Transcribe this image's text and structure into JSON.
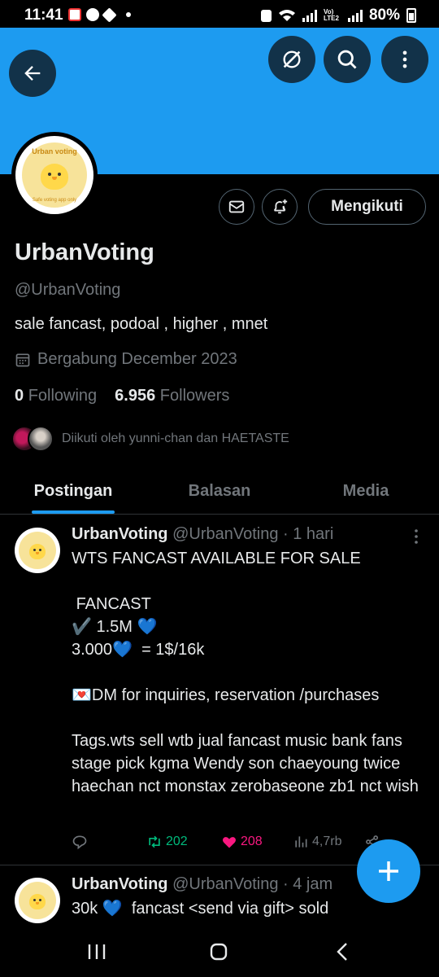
{
  "status_bar": {
    "time": "11:41",
    "battery": "80%",
    "lte_label": "Vo) LTE2"
  },
  "header": {
    "back_icon": "arrow-left-icon",
    "grok_icon": "slash-circle-icon",
    "search_icon": "search-icon",
    "more_icon": "vertical-dots-icon"
  },
  "profile": {
    "avatar_top_text": "Urban voting",
    "avatar_bottom_text": "Safe voting app only",
    "follow_button_label": "Mengikuti",
    "name": "UrbanVoting",
    "handle": "@UrbanVoting",
    "bio": "sale fancast, podoal , higher , mnet",
    "joined": "Bergabung December 2023",
    "following_count": "0",
    "following_label": "Following",
    "followers_count": "6.956",
    "followers_label": "Followers",
    "followed_by": "Diikuti oleh yunni-chan dan HAETASTE"
  },
  "tabs": [
    {
      "label": "Postingan",
      "active": true
    },
    {
      "label": "Balasan",
      "active": false
    },
    {
      "label": "Media",
      "active": false
    }
  ],
  "posts": [
    {
      "name": "UrbanVoting",
      "meta": "@UrbanVoting · 1 hari",
      "body": "WTS FANCAST AVAILABLE FOR SALE\n\n FANCAST\n✔️ 1.5M 💙\n3.000💙  = 1$/16k\n\n💌DM for inquiries, reservation /purchases\n\nTags.wts sell wtb jual fancast music bank fans stage pick kgma Wendy son chaeyoung twice haechan nct monstax zerobaseone zb1 nct wish",
      "retweets": "202",
      "likes": "208",
      "views": "4,7rb"
    },
    {
      "name": "UrbanVoting",
      "meta": "@UrbanVoting · 4 jam",
      "body": "30k 💙  fancast <send via gift> sold"
    }
  ],
  "colors": {
    "accent": "#1d9bf0",
    "retweet": "#00ba7c",
    "like": "#f91880",
    "muted": "#71767b"
  }
}
